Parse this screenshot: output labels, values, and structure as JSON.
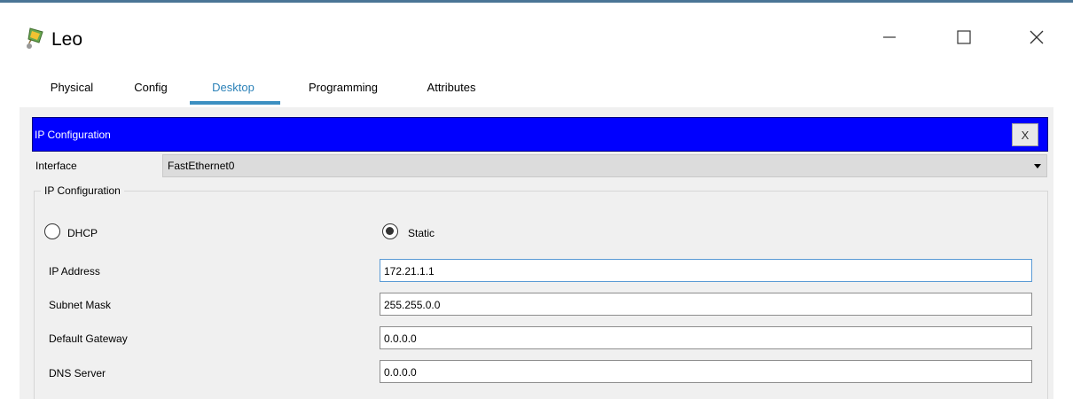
{
  "window": {
    "title": "Leo",
    "icon": "pc-device-icon",
    "controls": {
      "minimize": "—",
      "maximize": "☐",
      "close": "✕"
    }
  },
  "tabs": [
    {
      "label": "Physical",
      "active": false
    },
    {
      "label": "Config",
      "active": false
    },
    {
      "label": "Desktop",
      "active": true
    },
    {
      "label": "Programming",
      "active": false
    },
    {
      "label": "Attributes",
      "active": false
    }
  ],
  "ip_config": {
    "header_title": "IP Configuration",
    "close_label": "X",
    "interface_label": "Interface",
    "interface_value": "FastEthernet0",
    "group_title": "IP Configuration",
    "mode": {
      "dhcp_label": "DHCP",
      "static_label": "Static",
      "selected": "Static"
    },
    "fields": {
      "ip_address": {
        "label": "IP Address",
        "value": "172.21.1.1"
      },
      "subnet_mask": {
        "label": "Subnet Mask",
        "value": "255.255.0.0"
      },
      "default_gateway": {
        "label": "Default Gateway",
        "value": "0.0.0.0"
      },
      "dns_server": {
        "label": "DNS Server",
        "value": "0.0.0.0"
      }
    }
  },
  "colors": {
    "header_bar": "#0000ff",
    "active_tab": "#2c82b8",
    "window_border": "#4a7596"
  }
}
